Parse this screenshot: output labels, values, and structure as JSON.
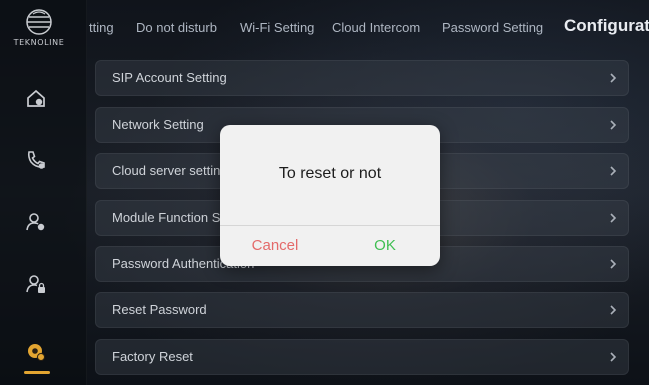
{
  "brand": {
    "name": "TEKNOLINE"
  },
  "sidebar": {
    "icons": [
      {
        "name": "home-config-icon"
      },
      {
        "name": "phone-icon"
      },
      {
        "name": "user-settings-icon"
      },
      {
        "name": "user-lock-icon"
      },
      {
        "name": "settings-gear-icon",
        "active": true
      }
    ],
    "accent_color": "#e3a531"
  },
  "tabs": [
    {
      "label": "tting"
    },
    {
      "label": "Do not disturb"
    },
    {
      "label": "Wi-Fi Setting"
    },
    {
      "label": "Cloud Intercom"
    },
    {
      "label": "Password Setting"
    },
    {
      "label": "Configurat",
      "active": true
    }
  ],
  "menu": {
    "items": [
      {
        "label": "SIP Account Setting"
      },
      {
        "label": "Network Setting"
      },
      {
        "label": "Cloud server setting"
      },
      {
        "label": "Module Function Se"
      },
      {
        "label": "Password Authentication"
      },
      {
        "label": "Reset Password"
      },
      {
        "label": "Factory Reset"
      }
    ]
  },
  "dialog": {
    "message": "To reset or not",
    "cancel_label": "Cancel",
    "ok_label": "OK",
    "cancel_color": "#e46a6a",
    "ok_color": "#3fbf52"
  }
}
